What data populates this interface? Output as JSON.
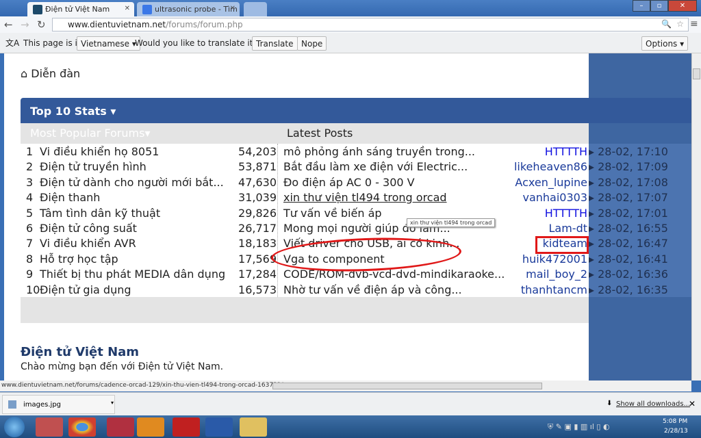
{
  "browser": {
    "tabs": [
      {
        "title": "Điện tử Việt Nam",
        "active": true
      },
      {
        "title": "ultrasonic probe - Tìm với",
        "active": false
      }
    ],
    "url_host": "www.dientuvietnam.net",
    "url_path": "/forums/forum.php",
    "translate": {
      "prefix": "This page is in",
      "language": "Vietnamese",
      "question": "Would you like to translate it?",
      "translate_btn": "Translate",
      "nope_btn": "Nope",
      "options_btn": "Options"
    },
    "status_url": "www.dientuvietnam.net/forums/cadence-orcad-129/xin-thu-vien-tl494-trong-orcad-163721/",
    "download": {
      "file": "images.jpg",
      "show_all": "Show all downloads..."
    }
  },
  "page": {
    "breadcrumb": "Diễn đàn",
    "stats_title": "Top 10 Stats",
    "col_forums": "Most Popular Forums",
    "col_posts": "Latest Posts",
    "tooltip": "xin thư viện tl494 trong orcad",
    "rows": [
      {
        "n": "1",
        "forum": "Vi điều khiển họ 8051",
        "count": "54,203",
        "post": "mô phỏng ánh sáng truyền trong...",
        "user": "HTTTTH",
        "date": "28-02, 17:10"
      },
      {
        "n": "2",
        "forum": "Điện tử truyền hình",
        "count": "53,871",
        "post": "Bắt đầu làm xe điện với Electric...",
        "user": "likeheaven86",
        "date": "28-02, 17:09"
      },
      {
        "n": "3",
        "forum": "Điện tử dành cho người mới bắt...",
        "count": "47,630",
        "post": "Đo điện áp AC 0 - 300 V",
        "user": "Acxen_lupine",
        "date": "28-02, 17:08"
      },
      {
        "n": "4",
        "forum": "Điện thanh",
        "count": "31,039",
        "post": "xin thư viện tl494 trong orcad",
        "user": "vanhai0303",
        "date": "28-02, 17:07"
      },
      {
        "n": "5",
        "forum": "Tâm tình dân kỹ thuật",
        "count": "29,826",
        "post": "Tư vấn về biến áp",
        "user": "HTTTTH",
        "date": "28-02, 17:01"
      },
      {
        "n": "6",
        "forum": "Điện tử công suất",
        "count": "26,717",
        "post": "Mong mọi người giúp đỡ làm...",
        "user": "Lam-dt",
        "date": "28-02, 16:55"
      },
      {
        "n": "7",
        "forum": "Vi điều khiển AVR",
        "count": "18,183",
        "post": "Viết driver cho USB, ai có kinh...",
        "user": "kidteam",
        "date": "28-02, 16:47"
      },
      {
        "n": "8",
        "forum": "Hỗ trợ học tập",
        "count": "17,569",
        "post": "Vga to component",
        "user": "huik472001",
        "date": "28-02, 16:41"
      },
      {
        "n": "9",
        "forum": "Thiết bị thu phát MEDIA dân dụng",
        "count": "17,284",
        "post": "CODE/ROM-dvb-vcd-dvd-mindikaraoke...",
        "user": "mail_boy_2",
        "date": "28-02, 16:36"
      },
      {
        "n": "10",
        "forum": "Điện tử gia dụng",
        "count": "16,573",
        "post": "Nhờ tư vấn về điện áp và công...",
        "user": "thanhtancm",
        "date": "28-02, 16:35"
      }
    ],
    "site_title": "Điện tử Việt Nam",
    "welcome": "Chào mừng bạn đến với Điện tử Việt Nam."
  },
  "taskbar": {
    "time": "5:08 PM",
    "date": "2/28/13"
  },
  "colors": {
    "header_blue": "#33599a",
    "annotation_red": "#e01818"
  }
}
